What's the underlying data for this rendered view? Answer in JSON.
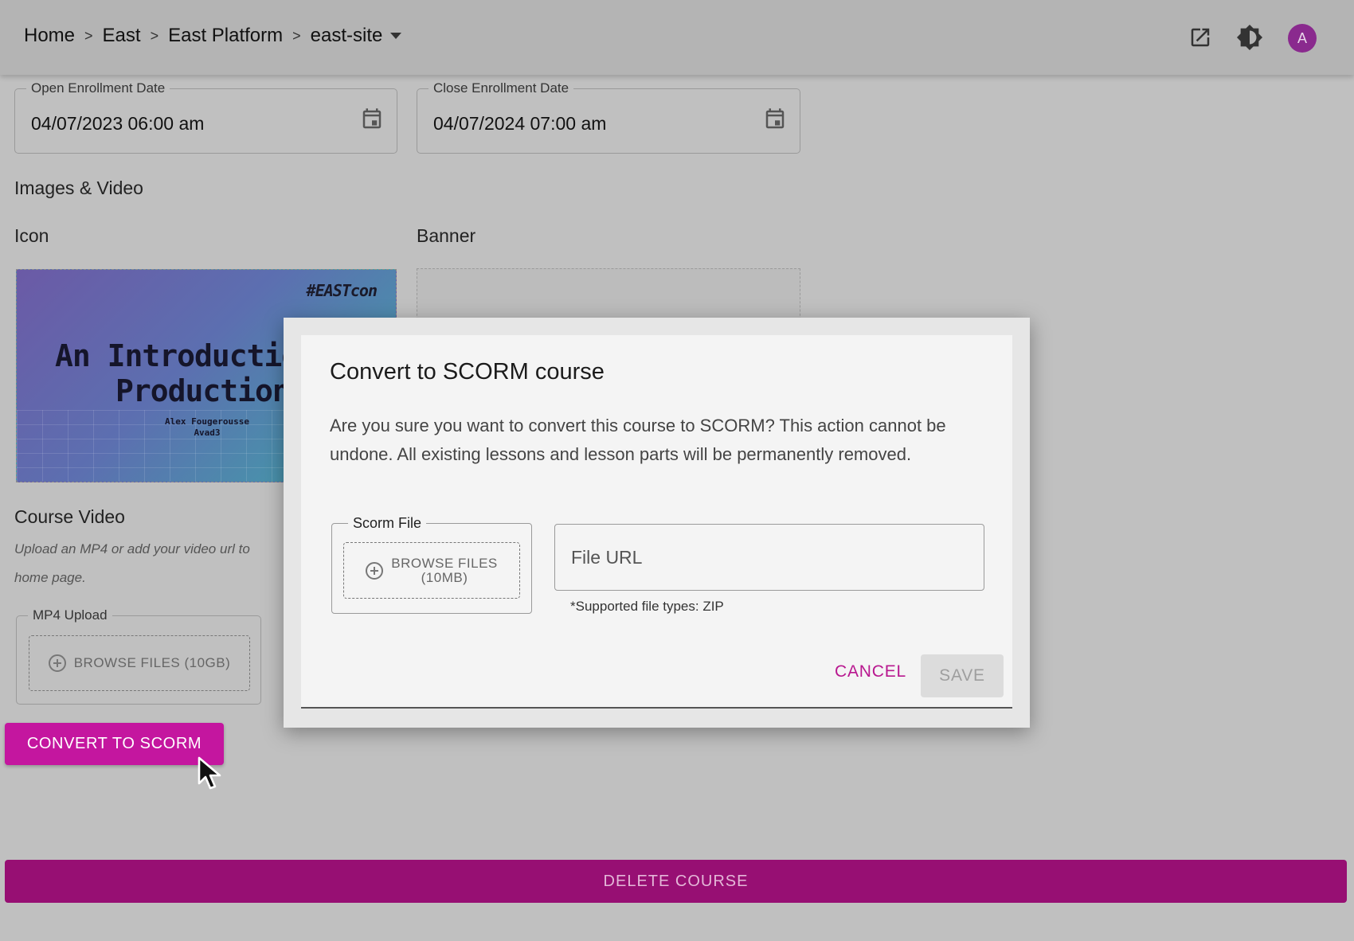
{
  "header": {
    "breadcrumb": [
      "Home",
      "East",
      "East Platform",
      "east-site"
    ],
    "separator": ">",
    "avatar_initial": "A",
    "icons": [
      "open-in-new-icon",
      "brightness-icon",
      "avatar"
    ]
  },
  "form": {
    "open_enrollment": {
      "label": "Open Enrollment Date",
      "value": "04/07/2023 06:00 am"
    },
    "close_enrollment": {
      "label": "Close Enrollment Date",
      "value": "04/07/2024 07:00 am"
    },
    "images_video_title": "Images & Video",
    "icon_label": "Icon",
    "banner_label": "Banner",
    "icon_preview": {
      "tag": "#EASTcon",
      "line1": "An Introductio",
      "line2": "Production",
      "author": "Alex Fougerousse",
      "author_sub": "Avad3"
    },
    "course_video_title": "Course Video",
    "course_video_help": "Upload an MP4 or add your video url to home page.",
    "mp4_upload": {
      "label": "MP4 Upload",
      "browse": "BROWSE FILES (10GB)"
    },
    "convert_button": "CONVERT TO SCORM",
    "delete_button": "DELETE COURSE"
  },
  "dialog": {
    "title": "Convert to SCORM course",
    "message": "Are you sure you want to convert this course to SCORM? This action cannot be undone. All existing lessons and lesson parts will be permanently removed.",
    "scorm_file_label": "Scorm File",
    "browse_line1": "BROWSE FILES",
    "browse_line2": "(10MB)",
    "url_placeholder": "File URL",
    "url_value": "",
    "supported_types": "*Supported file types: ZIP",
    "cancel": "CANCEL",
    "save": "SAVE"
  },
  "colors": {
    "accent": "#c4169f",
    "delete": "#970f73",
    "avatar": "#8a2a8e",
    "overlay_bg": "#c0c0c0"
  }
}
